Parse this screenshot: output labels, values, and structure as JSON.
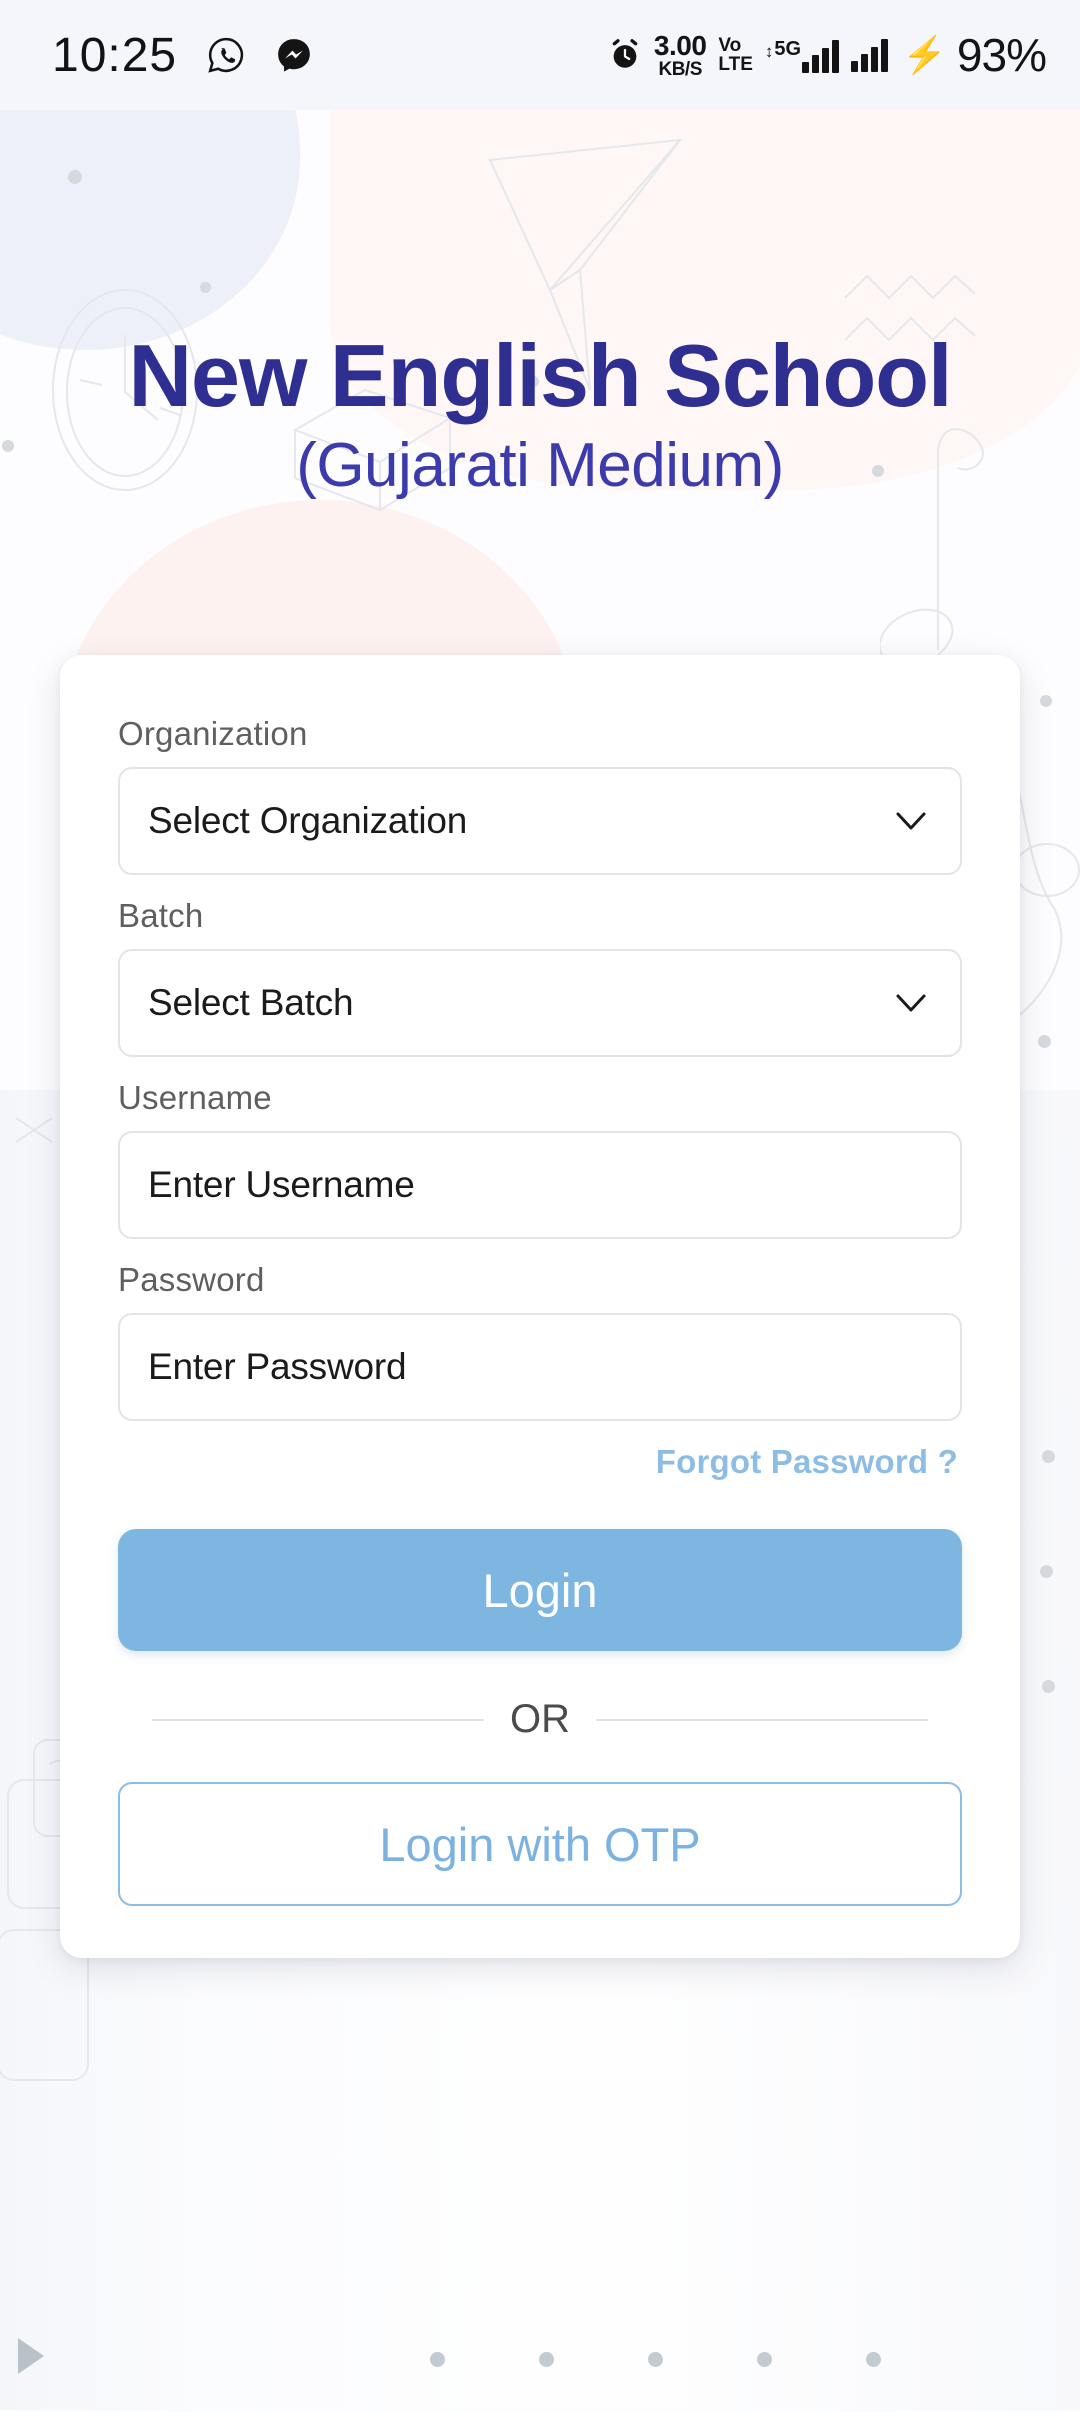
{
  "statusbar": {
    "time": "10:25",
    "apps": [
      "whatsapp-icon",
      "messenger-icon"
    ],
    "alarm_icon": "alarm-icon",
    "net_speed_value": "3.00",
    "net_speed_unit": "KB/S",
    "volte_line1": "Vo",
    "volte_line2": "LTE",
    "network_type": "5G",
    "battery_percent": "93%",
    "charging_icon": "lightning-bolt-icon"
  },
  "header": {
    "title": "New English School",
    "subtitle": "(Gujarati Medium)"
  },
  "form": {
    "organization": {
      "label": "Organization",
      "value": "Select Organization",
      "icon": "chevron-down-icon"
    },
    "batch": {
      "label": "Batch",
      "value": "Select Batch",
      "icon": "chevron-down-icon"
    },
    "username": {
      "label": "Username",
      "placeholder": "Enter Username",
      "value": ""
    },
    "password": {
      "label": "Password",
      "placeholder": "Enter Password",
      "value": ""
    },
    "forgot_password": "Forgot Password ?",
    "login_button": "Login",
    "divider": "OR",
    "otp_button": "Login with OTP"
  },
  "colors": {
    "title_blue": "#2f2f92",
    "subtitle_blue": "#3b3bab",
    "primary_button": "#7eb6e2",
    "link_blue": "#8ebde3",
    "outline_blue": "#8cbde4",
    "label_grey": "#5f5f5f",
    "field_border": "#e3e4e7",
    "page_bg": "#fdfdff",
    "statusbar_bg": "#f4f6fb"
  }
}
